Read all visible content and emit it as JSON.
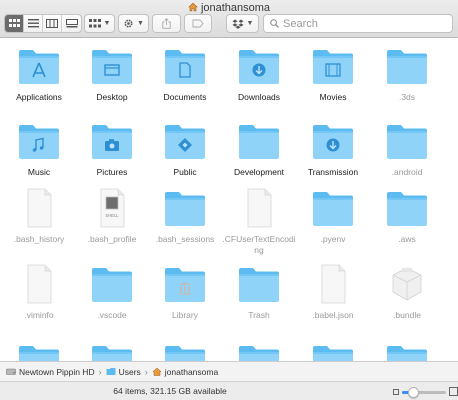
{
  "window": {
    "title": "jonathansoma"
  },
  "toolbar": {
    "views": [
      "icon-view",
      "list-view",
      "column-view",
      "cover-flow-view"
    ],
    "active_view": 0,
    "search_placeholder": "Search"
  },
  "colors": {
    "folder_light": "#8fd3f8",
    "folder_dark": "#56b8ef",
    "accent": "#3d8ff5"
  },
  "items": [
    {
      "label": "Applications",
      "type": "folder",
      "glyph": "applications",
      "dim": false
    },
    {
      "label": "Desktop",
      "type": "folder",
      "glyph": "desktop",
      "dim": false
    },
    {
      "label": "Documents",
      "type": "folder",
      "glyph": "documents",
      "dim": false
    },
    {
      "label": "Downloads",
      "type": "folder",
      "glyph": "downloads",
      "dim": false
    },
    {
      "label": "Movies",
      "type": "folder",
      "glyph": "movies",
      "dim": false
    },
    {
      "label": ".3ds",
      "type": "folder",
      "glyph": "none",
      "dim": true
    },
    {
      "label": "Music",
      "type": "folder",
      "glyph": "music",
      "dim": false
    },
    {
      "label": "Pictures",
      "type": "folder",
      "glyph": "pictures",
      "dim": false
    },
    {
      "label": "Public",
      "type": "folder",
      "glyph": "public",
      "dim": false
    },
    {
      "label": "Development",
      "type": "folder",
      "glyph": "none",
      "dim": false
    },
    {
      "label": "Transmission",
      "type": "folder",
      "glyph": "downloads",
      "dim": false
    },
    {
      "label": ".android",
      "type": "folder",
      "glyph": "none",
      "dim": true
    },
    {
      "label": ".bash_history",
      "type": "file",
      "glyph": "none",
      "dim": true
    },
    {
      "label": ".bash_profile",
      "type": "file",
      "glyph": "shell",
      "dim": true
    },
    {
      "label": ".bash_sessions",
      "type": "folder",
      "glyph": "none",
      "dim": true
    },
    {
      "label": ".CFUserTextEncoding",
      "type": "file",
      "glyph": "none",
      "dim": true
    },
    {
      "label": ".pyenv",
      "type": "folder",
      "glyph": "none",
      "dim": true
    },
    {
      "label": ".aws",
      "type": "folder",
      "glyph": "none",
      "dim": true
    },
    {
      "label": ".viminfo",
      "type": "file",
      "glyph": "none",
      "dim": true
    },
    {
      "label": ".vscode",
      "type": "folder",
      "glyph": "none",
      "dim": true
    },
    {
      "label": "Library",
      "type": "folder",
      "glyph": "library",
      "dim": true
    },
    {
      "label": "Trash",
      "type": "folder",
      "glyph": "none",
      "dim": true
    },
    {
      "label": ".babel.json",
      "type": "file",
      "glyph": "none",
      "dim": true
    },
    {
      "label": ".bundle",
      "type": "bundle",
      "glyph": "none",
      "dim": true
    },
    {
      "label": "",
      "type": "folder",
      "glyph": "none",
      "dim": true
    },
    {
      "label": "",
      "type": "folder",
      "glyph": "none",
      "dim": true
    },
    {
      "label": "",
      "type": "folder",
      "glyph": "none",
      "dim": true
    },
    {
      "label": "",
      "type": "folder",
      "glyph": "none",
      "dim": true
    },
    {
      "label": "",
      "type": "folder",
      "glyph": "none",
      "dim": true
    },
    {
      "label": "",
      "type": "folder",
      "glyph": "none",
      "dim": true
    }
  ],
  "shell_badge": "SHELL",
  "pathbar": [
    {
      "label": "Newtown Pippin HD",
      "icon": "disk-icon"
    },
    {
      "label": "Users",
      "icon": "folder-icon"
    },
    {
      "label": "jonathansoma",
      "icon": "home-icon"
    }
  ],
  "status": {
    "text": "64 items, 321.15 GB available",
    "zoom_fraction": 0.25
  }
}
